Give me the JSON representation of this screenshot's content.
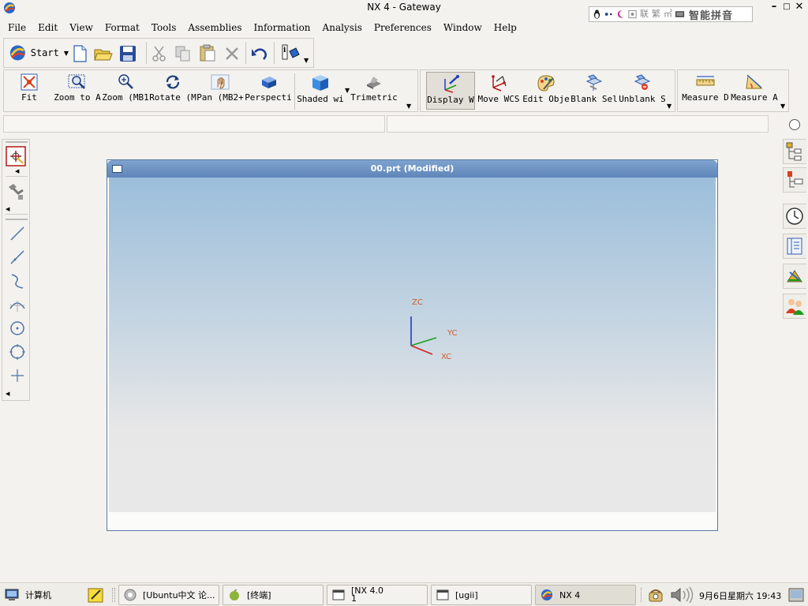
{
  "window": {
    "title": "NX 4 - Gateway",
    "minimize_glyph": "–",
    "maximize_glyph": "□",
    "close_glyph": "✕"
  },
  "ime": {
    "cells": [
      "联",
      "繁",
      "㎡"
    ],
    "name": "智能拼音"
  },
  "menu": [
    "File",
    "Edit",
    "View",
    "Format",
    "Tools",
    "Assemblies",
    "Information",
    "Analysis",
    "Preferences",
    "Window",
    "Help"
  ],
  "standard_toolbar": {
    "start_label": "Start"
  },
  "view_toolbar": [
    {
      "label": "Fit",
      "icon": "fit-icon"
    },
    {
      "label": "Zoom to A",
      "icon": "zoom-area-icon"
    },
    {
      "label": "Zoom (MB1",
      "icon": "zoom-icon"
    },
    {
      "label": "Rotate (M",
      "icon": "rotate-icon"
    },
    {
      "label": "Pan (MB2+",
      "icon": "pan-icon"
    },
    {
      "label": "Perspecti",
      "icon": "perspective-icon"
    },
    {
      "label": "Shaded wi",
      "icon": "shaded-icon"
    },
    {
      "label": "Trimetric",
      "icon": "trimetric-icon"
    }
  ],
  "utility_toolbar": [
    {
      "label": "Display W",
      "icon": "display-wcs-icon"
    },
    {
      "label": "Move WCS",
      "icon": "move-wcs-icon"
    },
    {
      "label": "Edit Obje",
      "icon": "edit-object-icon"
    },
    {
      "label": "Blank Sel",
      "icon": "blank-icon"
    },
    {
      "label": "Unblank S",
      "icon": "unblank-icon"
    }
  ],
  "measure_toolbar": [
    {
      "label": "Measure D",
      "icon": "measure-distance-icon"
    },
    {
      "label": "Measure A",
      "icon": "measure-angle-icon"
    }
  ],
  "graphics": {
    "title": "00.prt (Modified)",
    "axes": {
      "z": "ZC",
      "y": "YC",
      "x": "XC"
    }
  },
  "taskbar": {
    "computer_label": "计算机",
    "tasks": [
      {
        "label": "[Ubuntu中文 论...",
        "icon": "browser-icon"
      },
      {
        "label": "[终端]",
        "icon": "terminal-icon"
      },
      {
        "label": "[NX 4.0\n1",
        "icon": "window-icon"
      },
      {
        "label": "[ugii]",
        "icon": "window-icon"
      },
      {
        "label": "NX 4",
        "icon": "nx-icon"
      }
    ],
    "clock": "9月6日星期六 19:43"
  }
}
